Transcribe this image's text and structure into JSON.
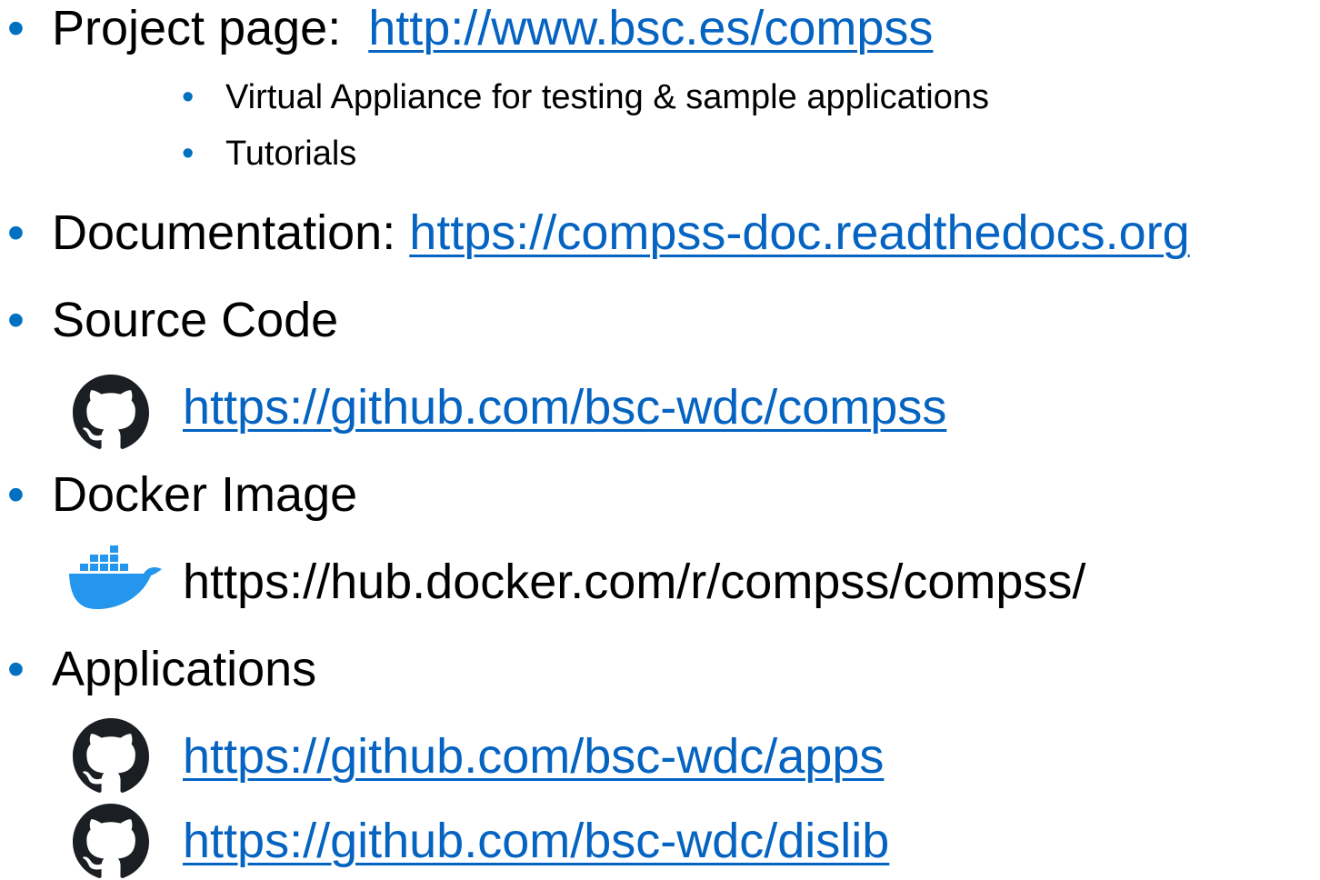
{
  "bullet_char": "•",
  "project": {
    "label": "Project page:",
    "url": "http://www.bsc.es/compss",
    "subitems": [
      "Virtual Appliance for testing & sample applications",
      "Tutorials"
    ]
  },
  "documentation": {
    "label": "Documentation:",
    "url": "https://compss-doc.readthedocs.org"
  },
  "source_code": {
    "label": "Source Code",
    "url": "https://github.com/bsc-wdc/compss",
    "icon": "github-icon"
  },
  "docker_image": {
    "label": "Docker Image",
    "url": "https://hub.docker.com/r/compss/compss/",
    "icon": "docker-icon"
  },
  "applications": {
    "label": "Applications",
    "links": [
      {
        "url": "https://github.com/bsc-wdc/apps",
        "icon": "github-icon"
      },
      {
        "url": "https://github.com/bsc-wdc/dislib",
        "icon": "github-icon"
      }
    ]
  },
  "colors": {
    "bullet": "#0070c0",
    "link": "#0563c1",
    "text": "#000000",
    "docker_blue": "#2496ed"
  }
}
